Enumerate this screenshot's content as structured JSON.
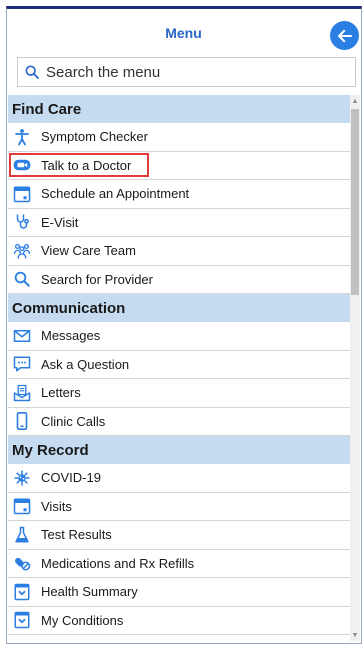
{
  "header": {
    "title": "Menu"
  },
  "search": {
    "placeholder": "Search the menu"
  },
  "sections": [
    {
      "title": "Find Care",
      "items": [
        {
          "label": "Symptom Checker",
          "icon": "person-icon"
        },
        {
          "label": "Talk to a Doctor",
          "icon": "video-icon",
          "highlighted": true
        },
        {
          "label": "Schedule an Appointment",
          "icon": "calendar-icon"
        },
        {
          "label": "E-Visit",
          "icon": "stethoscope-icon"
        },
        {
          "label": "View Care Team",
          "icon": "team-icon"
        },
        {
          "label": "Search for Provider",
          "icon": "search-icon"
        }
      ]
    },
    {
      "title": "Communication",
      "items": [
        {
          "label": "Messages",
          "icon": "envelope-icon"
        },
        {
          "label": "Ask a Question",
          "icon": "chat-icon"
        },
        {
          "label": "Letters",
          "icon": "letter-icon"
        },
        {
          "label": "Clinic Calls",
          "icon": "phone-icon"
        }
      ]
    },
    {
      "title": "My Record",
      "items": [
        {
          "label": "COVID-19",
          "icon": "virus-icon"
        },
        {
          "label": "Visits",
          "icon": "calendar-icon"
        },
        {
          "label": "Test Results",
          "icon": "flask-icon"
        },
        {
          "label": "Medications and Rx Refills",
          "icon": "pills-icon"
        },
        {
          "label": "Health Summary",
          "icon": "summary-icon"
        },
        {
          "label": "My Conditions",
          "icon": "conditions-icon"
        }
      ]
    }
  ],
  "colors": {
    "accent": "#2b67c7",
    "section_bg": "#c5dcf0",
    "highlight": "#e23b3b",
    "icon": "#2b7fe3"
  }
}
